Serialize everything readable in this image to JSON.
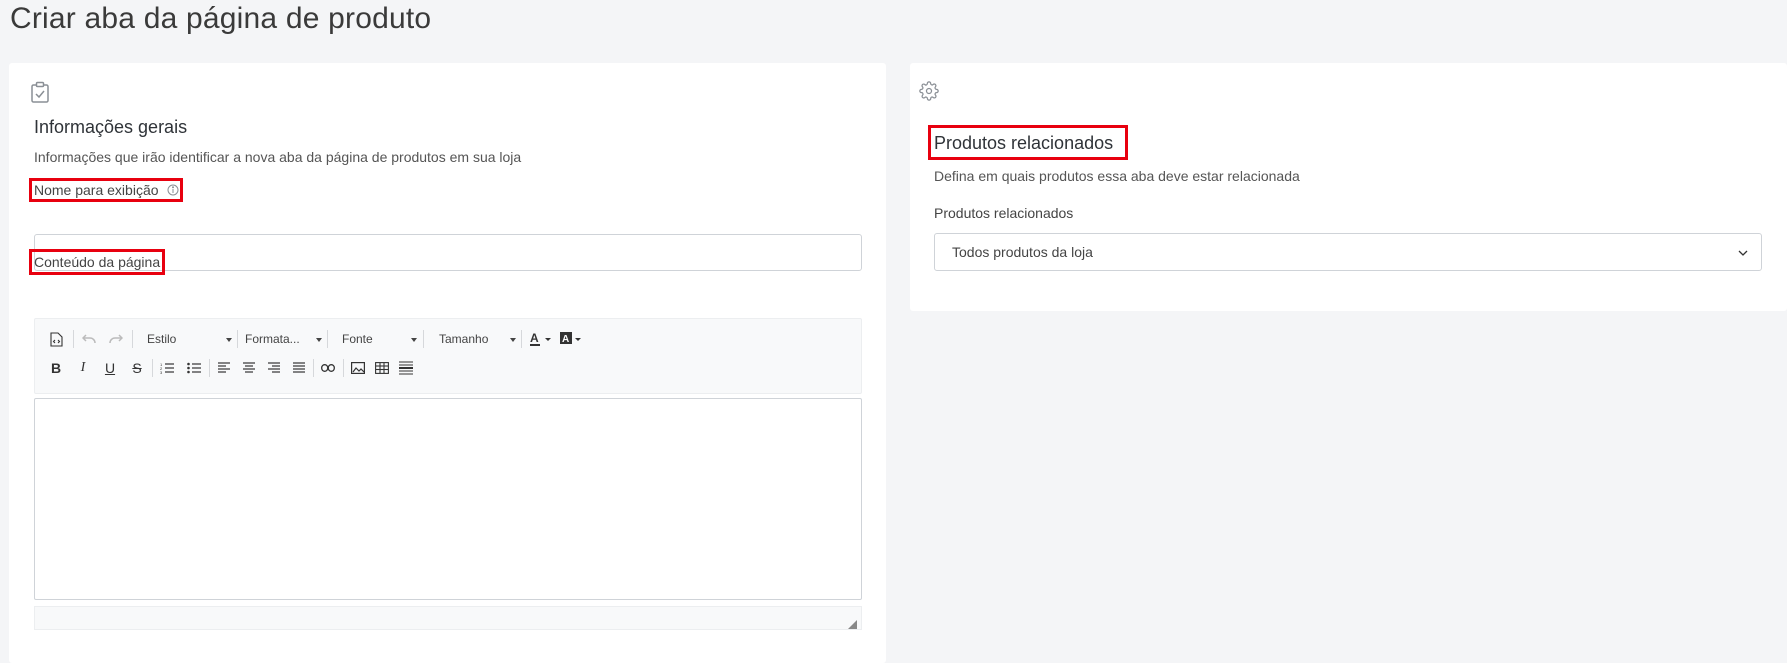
{
  "page": {
    "title": "Criar aba da página de produto"
  },
  "general": {
    "icon": "clipboard-check-icon",
    "title": "Informações gerais",
    "subtitle": "Informações que irão identificar a nova aba da página de produtos em sua loja",
    "display_name_label": "Nome para exibição",
    "info_icon": "info-circle-icon",
    "display_name_value": "",
    "content_label": "Conteúdo da página"
  },
  "editor": {
    "combos": {
      "style": "Estilo",
      "format": "Formata...",
      "font": "Fonte",
      "size": "Tamanho"
    },
    "content": ""
  },
  "related": {
    "icon": "gear-icon",
    "title": "Produtos relacionados",
    "subtitle": "Defina em quais produtos essa aba deve estar relacionada",
    "field_label": "Produtos relacionados",
    "selected": "Todos produtos da loja"
  },
  "colors": {
    "highlight": "#e8000f",
    "background": "#f4f5f7",
    "card": "#ffffff"
  }
}
